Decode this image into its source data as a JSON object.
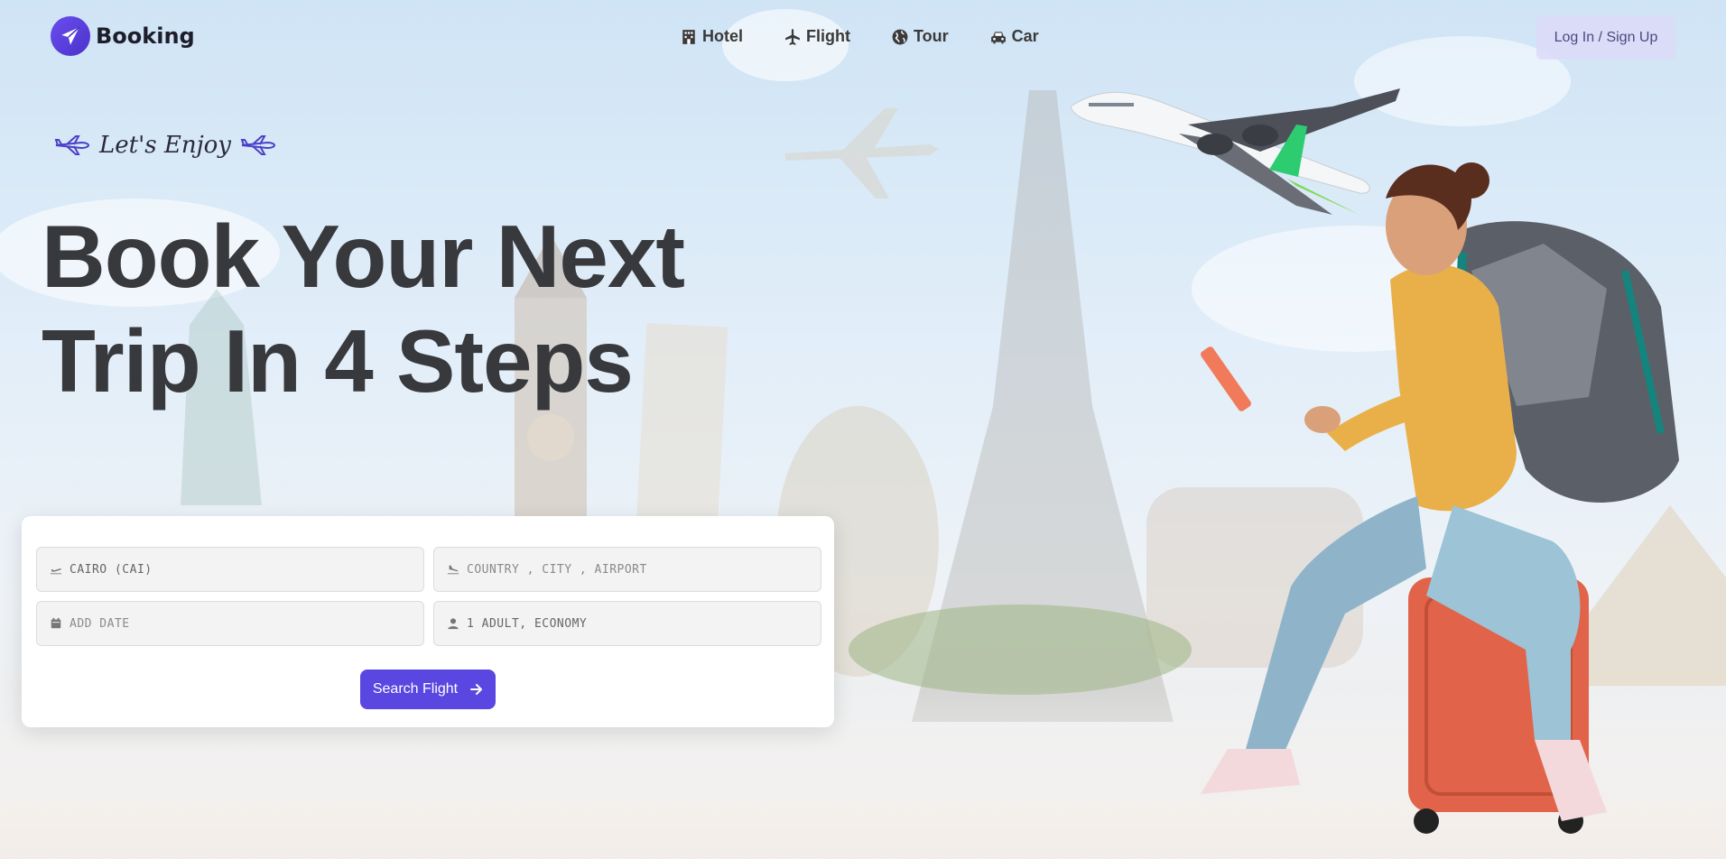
{
  "brand": {
    "name": "Booking",
    "accent": "#5a46e0"
  },
  "nav": {
    "items": [
      {
        "label": "Hotel",
        "icon": "hotel-icon"
      },
      {
        "label": "Flight",
        "icon": "plane-icon"
      },
      {
        "label": "Tour",
        "icon": "globe-icon"
      },
      {
        "label": "Car",
        "icon": "car-icon"
      }
    ],
    "auth_label": "Log In / Sign Up"
  },
  "hero": {
    "tagline": "Let's Enjoy",
    "headline_line1": "Book Your Next",
    "headline_line2": "Trip In 4 Steps"
  },
  "search": {
    "from_value": "CAIRO (CAI)",
    "to_placeholder": "COUNTRY , CITY , AIRPORT",
    "date_placeholder": "ADD DATE",
    "passengers_value": "1 ADULT, ECONOMY",
    "button_label": "Search Flight"
  }
}
